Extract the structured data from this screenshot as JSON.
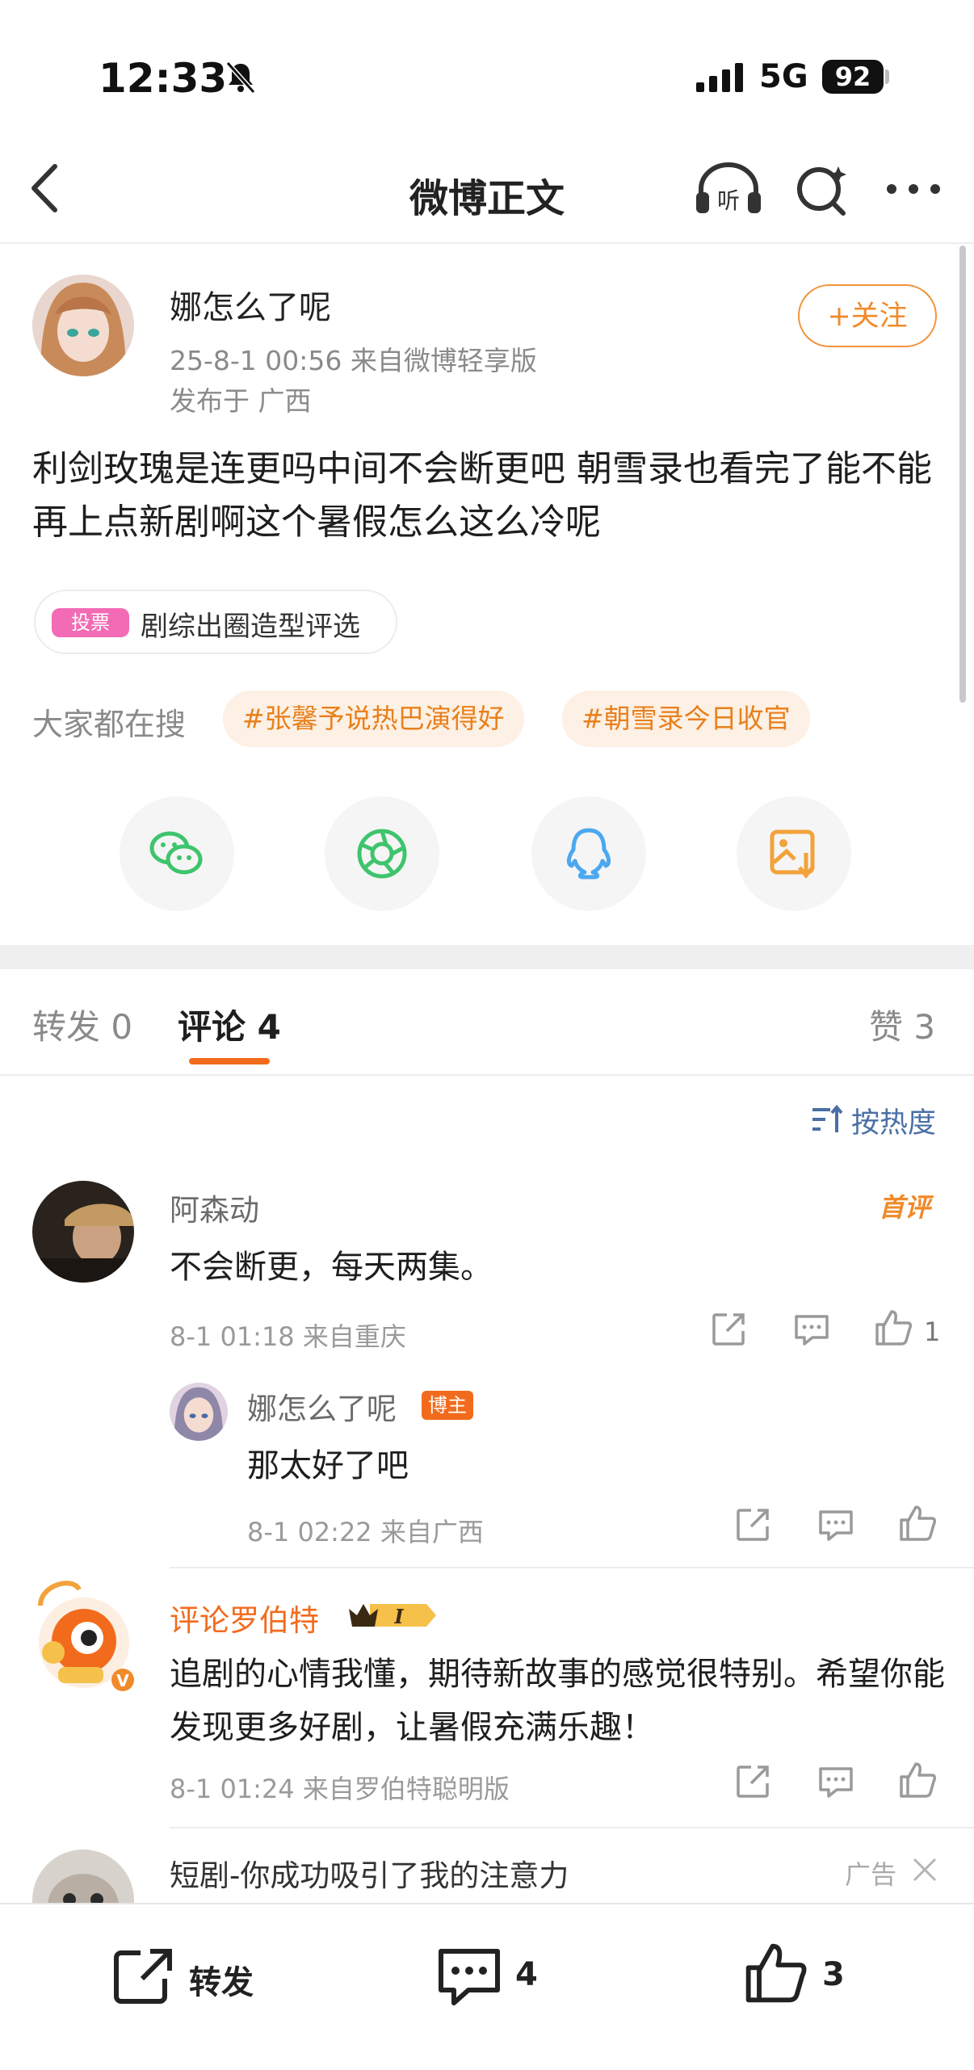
{
  "status_bar": {
    "time": "12:33",
    "network": "5G",
    "battery": "92"
  },
  "nav": {
    "title": "微博正文"
  },
  "post": {
    "author": "娜怎么了呢",
    "timestamp_source": "25-8-1 00:56  来自微博轻享版",
    "location": "发布于 广西",
    "follow_label": "+关注",
    "text": "利剑玫瑰是连更吗中间不会断更吧 朝雪录也看完了能不能再上点新剧啊这个暑假怎么这么冷呢",
    "vote_badge": "投票",
    "vote_label": "剧综出圈造型评选",
    "search_label": "大家都在搜",
    "tags": [
      "#张馨予说热巴演得好",
      "#朝雪录今日收官"
    ]
  },
  "share_targets": [
    {
      "icon": "wechat-icon",
      "color": "#3ec46d"
    },
    {
      "icon": "moments-icon",
      "color": "#3ec46d"
    },
    {
      "icon": "qq-icon",
      "color": "#4aa8f0"
    },
    {
      "icon": "save-image-icon",
      "color": "#f2a23a"
    }
  ],
  "tabs": {
    "repost": "转发 0",
    "comments": "评论 4",
    "likes": "赞 3",
    "active": "comments"
  },
  "sort_label": "按热度",
  "comments": [
    {
      "name": "阿森动",
      "badge": "首评",
      "text": "不会断更，每天两集。",
      "meta": "8-1 01:18  来自重庆",
      "like_count": "1",
      "reply": {
        "name": "娜怎么了呢",
        "badge": "博主",
        "text": "那太好了吧",
        "meta": "8-1 02:22  来自广西"
      }
    },
    {
      "name": "评论罗伯特",
      "text": "追剧的心情我懂，期待新故事的感觉很特别。希望你能发现更多好剧，让暑假充满乐趣！",
      "meta": "8-1 01:24  来自罗伯特聪明版"
    }
  ],
  "ad": {
    "title": "短剧-你成功吸引了我的注意力",
    "label": "广告"
  },
  "bottom_bar": {
    "repost_label": "转发",
    "comment_count": "4",
    "like_count": "3"
  },
  "colors": {
    "accent": "#f26b1d",
    "follow": "#f08a2a",
    "sort": "#4a6fa5"
  }
}
